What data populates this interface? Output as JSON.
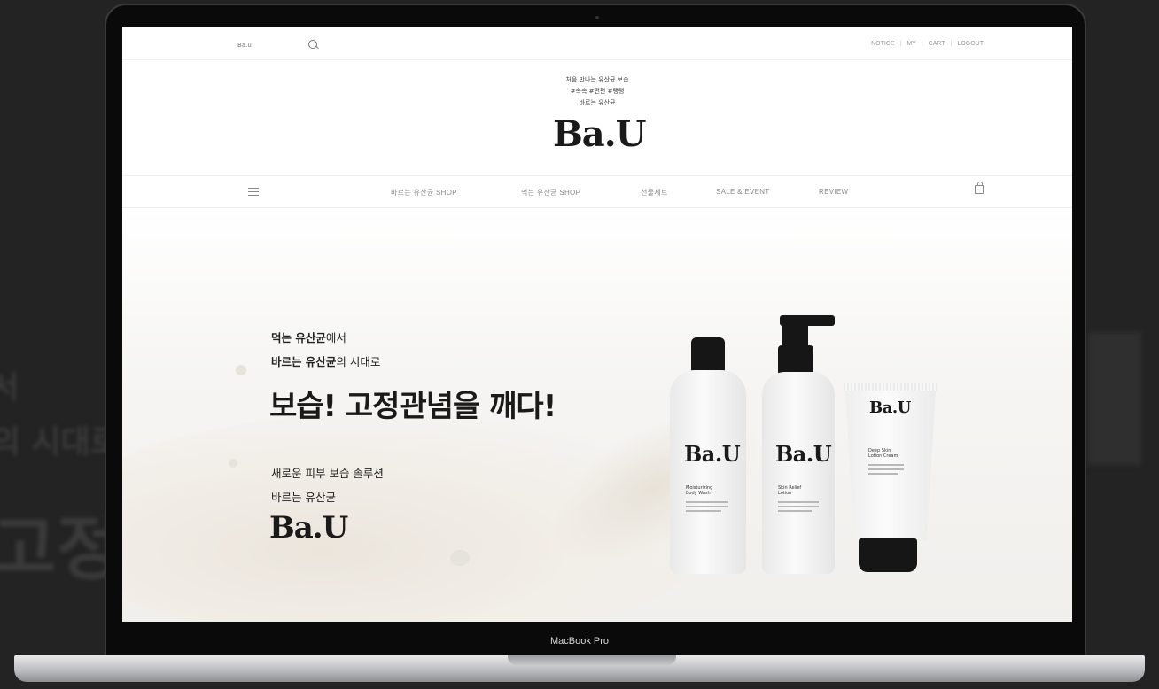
{
  "device": {
    "model_label": "MacBook Pro"
  },
  "site": {
    "search": {
      "placeholder": "Ba.u"
    },
    "util_links": [
      "NOTICE",
      "MY",
      "CART",
      "LOGOUT"
    ],
    "tagline_lines": [
      "처음 만나는 유산균 보습",
      "#촉촉 #편편 #탱탱",
      "바르는 유산균"
    ],
    "logo": "Ba.U",
    "nav": [
      "바르는 유산균 SHOP",
      "먹는 유산균 SHOP",
      "선물세트",
      "SALE & EVENT",
      "REVIEW"
    ],
    "hero": {
      "line1_bold": "먹는 유산균",
      "line1_rest": "에서",
      "line2_bold": "바르는 유산균",
      "line2_rest": "의 시대로",
      "headline": "보습! 고정관념을 깨다!",
      "sub1": "새로운 피부 보습 솔루션",
      "sub2": "바르는 유산균",
      "logo": "Ba.U"
    },
    "products": [
      {
        "brand": "Ba.U",
        "name_line1": "Moisturizing",
        "name_line2": "Body Wash"
      },
      {
        "brand": "Ba.U",
        "name_line1": "Skin Relief",
        "name_line2": "Lotion"
      },
      {
        "brand": "Ba.U",
        "name_line1": "Deep Skin",
        "name_line2": "Lotion Cream"
      }
    ]
  }
}
